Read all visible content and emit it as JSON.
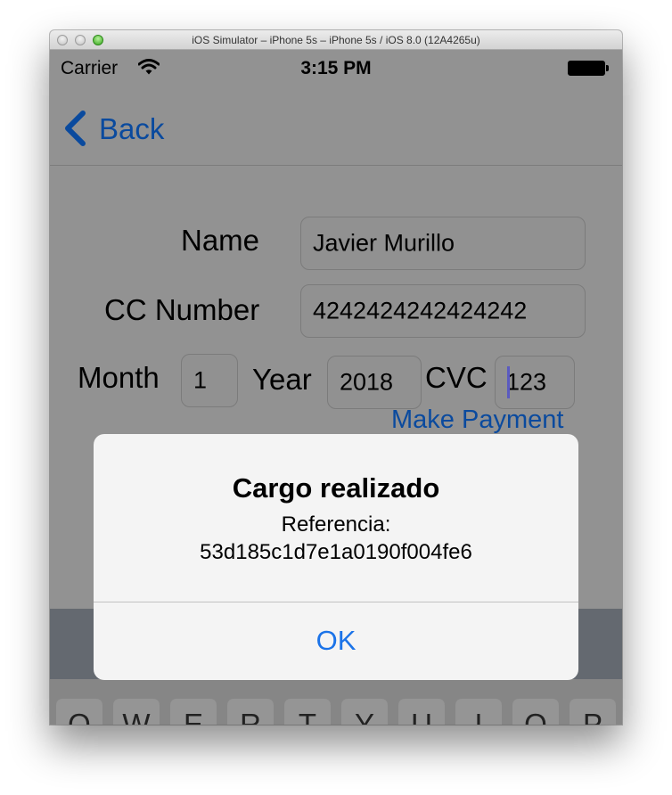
{
  "window": {
    "title": "iOS Simulator – iPhone 5s – iPhone 5s / iOS 8.0 (12A4265u)"
  },
  "statusbar": {
    "carrier": "Carrier",
    "time": "3:15 PM"
  },
  "navbar": {
    "back_label": "Back"
  },
  "form": {
    "name_label": "Name",
    "name_value": "Javier Murillo",
    "cc_label": "CC Number",
    "cc_value": "4242424242424242",
    "month_label": "Month",
    "month_value": "1",
    "year_label": "Year",
    "year_value": "2018",
    "cvc_label": "CVC",
    "cvc_value": "123",
    "submit_label": "Make Payment"
  },
  "alert": {
    "title": "Cargo realizado",
    "message_line1": "Referencia:",
    "message_line2": "53d185c1d7e1a0190f004fe6",
    "ok_label": "OK"
  },
  "keyboard": {
    "keys": [
      "Q",
      "W",
      "E",
      "R",
      "T",
      "Y",
      "U",
      "I",
      "O",
      "P"
    ]
  },
  "colors": {
    "link": "#0a4a9e",
    "alert_button": "#1b73e8",
    "zoom_button": "#35a51b"
  }
}
